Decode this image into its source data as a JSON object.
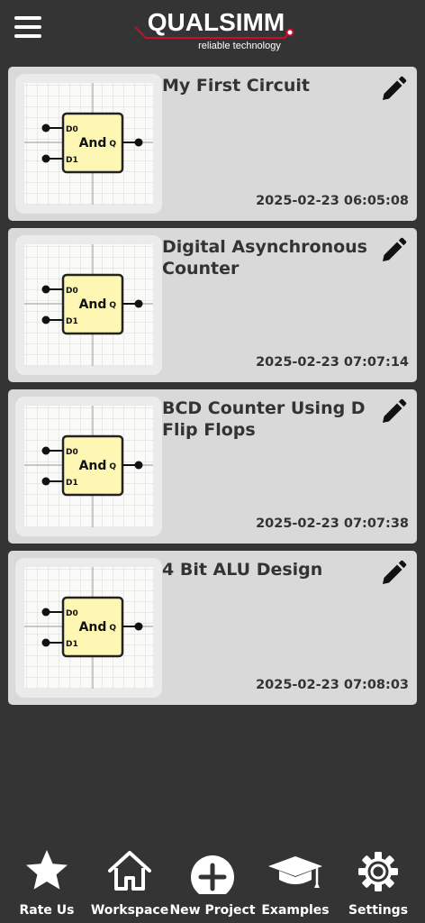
{
  "header": {
    "logo_text": "QUALSIMM",
    "logo_tagline": "reliable technology",
    "accent_color": "#c8102e"
  },
  "thumbnail": {
    "gate_label": "And",
    "input_a": "D0",
    "input_b": "D1",
    "output": "Q"
  },
  "projects": [
    {
      "title": "My First Circuit",
      "date": "2025-02-23 06:05:08"
    },
    {
      "title": "Digital Asynchronous Counter",
      "date": "2025-02-23 07:07:14"
    },
    {
      "title": "BCD Counter Using D Flip Flops",
      "date": "2025-02-23 07:07:38"
    },
    {
      "title": "4 Bit ALU Design",
      "date": "2025-02-23 07:08:03"
    }
  ],
  "nav": {
    "rate_us": "Rate Us",
    "workspace": "Workspace",
    "new_project": "New Project",
    "examples": "Examples",
    "settings": "Settings"
  }
}
